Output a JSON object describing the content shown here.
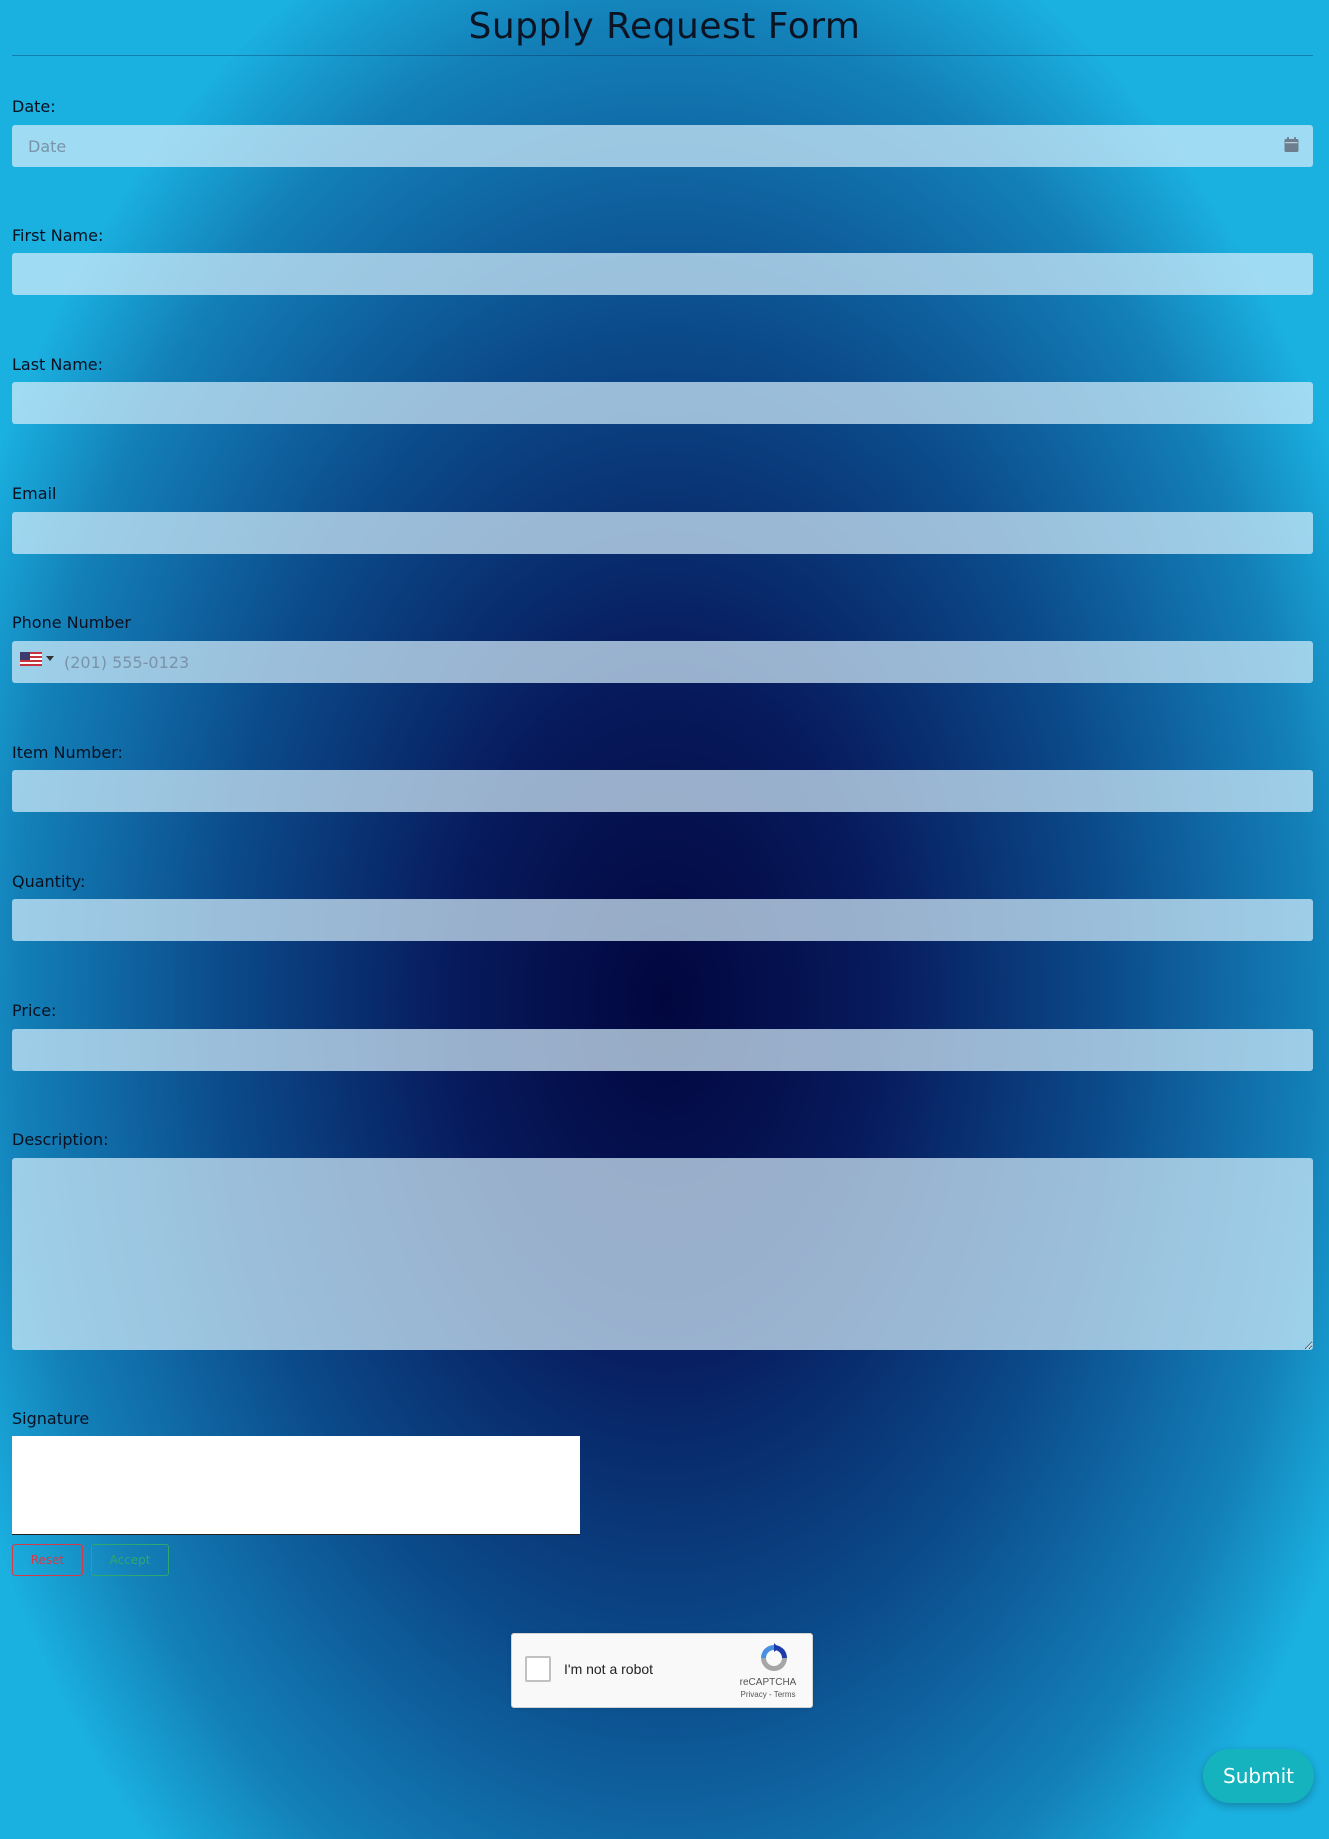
{
  "form": {
    "title": "Supply Request Form",
    "fields": {
      "date": {
        "label": "Date:",
        "placeholder": "Date",
        "value": ""
      },
      "first_name": {
        "label": "First Name:",
        "value": ""
      },
      "last_name": {
        "label": "Last Name:",
        "value": ""
      },
      "email": {
        "label": "Email",
        "value": ""
      },
      "phone": {
        "label": "Phone Number",
        "placeholder": "(201) 555-0123",
        "country": "US",
        "value": ""
      },
      "item_number": {
        "label": "Item Number:",
        "value": ""
      },
      "quantity": {
        "label": "Quantity:",
        "value": ""
      },
      "price": {
        "label": "Price:",
        "value": ""
      },
      "description": {
        "label": "Description:",
        "value": ""
      }
    },
    "signature": {
      "label": "Signature",
      "reset_label": "Reset",
      "accept_label": "Accept",
      "reset_color": "#d43a4a",
      "accept_color": "#2fa870"
    },
    "captcha": {
      "checkbox_label": "I'm not a robot",
      "brand": "reCAPTCHA",
      "links": "Privacy - Terms",
      "checked": false
    },
    "submit_label": "Submit"
  },
  "colors": {
    "submit_bg": "#14b3bd",
    "field_bg": "#cfe8f6",
    "background_center": "#02063e",
    "background_edge": "#1ab0e0"
  },
  "icons": {
    "date": "calendar-icon",
    "phone_country": "us-flag-icon",
    "phone_dropdown": "chevron-down-icon",
    "captcha": "recaptcha-logo-icon"
  }
}
